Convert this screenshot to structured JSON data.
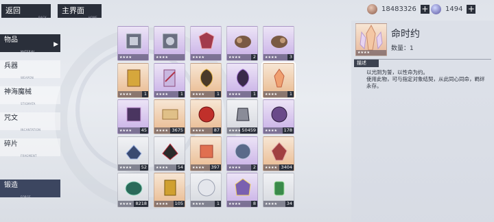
{
  "top": {
    "back": {
      "label": "返回",
      "sub": "BACK"
    },
    "main": {
      "label": "主界面",
      "sub": "HOME"
    }
  },
  "currencies": [
    {
      "value": "18483326",
      "icon": "avatar-currency-icon"
    },
    {
      "value": "1494",
      "icon": "gem-currency-icon"
    }
  ],
  "sidebar": [
    {
      "label": "物品",
      "sub": "MATERIAL"
    },
    {
      "label": "兵器",
      "sub": "WEAPON"
    },
    {
      "label": "神海魔械",
      "sub": "STIGMATA"
    },
    {
      "label": "咒文",
      "sub": "INCANTATION"
    },
    {
      "label": "碎片",
      "sub": "FRAGMENT"
    },
    {
      "label": "锻造",
      "sub": "FORGE"
    }
  ],
  "items": [
    {
      "rarity": "purple",
      "stars": "★★★★",
      "count": ""
    },
    {
      "rarity": "purple",
      "stars": "★★★★",
      "count": ""
    },
    {
      "rarity": "purple",
      "stars": "★★★★",
      "count": ""
    },
    {
      "rarity": "purple",
      "stars": "★★★★",
      "count": "2"
    },
    {
      "rarity": "purple",
      "stars": "★★★★",
      "count": "3"
    },
    {
      "rarity": "orange",
      "stars": "★★★★",
      "count": "1"
    },
    {
      "rarity": "purple",
      "stars": "★★★★",
      "count": "1"
    },
    {
      "rarity": "orange",
      "stars": "★★★★",
      "count": "1"
    },
    {
      "rarity": "purple",
      "stars": "★★★★",
      "count": "1"
    },
    {
      "rarity": "orange",
      "stars": "★★★★",
      "count": "1"
    },
    {
      "rarity": "purple",
      "stars": "★★★★",
      "count": "45"
    },
    {
      "rarity": "orange",
      "stars": "★★★★",
      "count": "3675"
    },
    {
      "rarity": "orange",
      "stars": "★★★★",
      "count": "87"
    },
    {
      "rarity": "gray",
      "stars": "★★★★",
      "count": "50459"
    },
    {
      "rarity": "purple",
      "stars": "★★★★",
      "count": "178"
    },
    {
      "rarity": "gray",
      "stars": "★★★★",
      "count": "52"
    },
    {
      "rarity": "gray",
      "stars": "★★★★",
      "count": "54"
    },
    {
      "rarity": "orange",
      "stars": "★★★★",
      "count": "397"
    },
    {
      "rarity": "purple",
      "stars": "★★★★",
      "count": "2"
    },
    {
      "rarity": "orange",
      "stars": "★★★★",
      "count": "3404"
    },
    {
      "rarity": "gray",
      "stars": "★★★★",
      "count": "8218"
    },
    {
      "rarity": "orange",
      "stars": "★★★★",
      "count": "105"
    },
    {
      "rarity": "gray",
      "stars": "★★★★",
      "count": "1"
    },
    {
      "rarity": "purple",
      "stars": "★★★★",
      "count": "8"
    },
    {
      "rarity": "gray",
      "stars": "★★★★",
      "count": "34"
    }
  ],
  "detail": {
    "name": "命时约",
    "quantity_label": "数量：1",
    "stars": "★★★★",
    "desc_tag": "描述",
    "desc_line1": "以光阴为誓，以性命为约。",
    "desc_line2": "使用此物，可与指定对象结契，从此同心同命，羁绊永存。"
  },
  "colors": {
    "dark": "#2a2f3a",
    "orange": "#e9b98e",
    "purple": "#c7aee6",
    "gray": "#d4d7dd"
  }
}
